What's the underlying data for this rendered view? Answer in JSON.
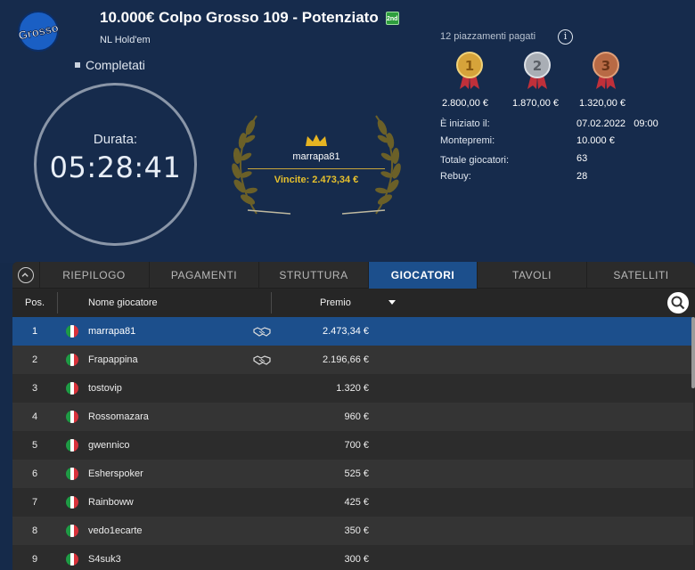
{
  "tournament": {
    "title": "10.000€ Colpo Grosso 109 - Potenziato",
    "badge": "2nd",
    "game_type": "NL Hold'em",
    "status": "Completati",
    "logo_text": "Grosso"
  },
  "clock": {
    "label": "Durata:",
    "time": "05:28:41"
  },
  "winner": {
    "name": "marrapa81",
    "prize": "Vincite: 2.473,34 €"
  },
  "payouts": {
    "places_text": "12 piazzamenti pagati",
    "medals": [
      {
        "rank": "1",
        "amount": "2.800,00 €",
        "color": "#d6a33a"
      },
      {
        "rank": "2",
        "amount": "1.870,00 €",
        "color": "#a9aeb5"
      },
      {
        "rank": "3",
        "amount": "1.320,00 €",
        "color": "#b86a45"
      }
    ]
  },
  "stats": [
    {
      "label": "È iniziato il:",
      "value": "07.02.2022   09:00"
    },
    {
      "label": "Montepremi:",
      "value": "10.000 €"
    },
    {
      "label": "Totale giocatori:",
      "value": "63"
    },
    {
      "label": "Rebuy:",
      "value": "28"
    }
  ],
  "tabs": [
    "RIEPILOGO",
    "PAGAMENTI",
    "STRUTTURA",
    "GIOCATORI",
    "TAVOLI",
    "SATELLITI"
  ],
  "active_tab": "GIOCATORI",
  "columns": {
    "pos": "Pos.",
    "name": "Nome giocatore",
    "prize": "Premio"
  },
  "players": [
    {
      "pos": "1",
      "name": "marrapa81",
      "deal": true,
      "prize": "2.473,34 €"
    },
    {
      "pos": "2",
      "name": "Frapappina",
      "deal": true,
      "prize": "2.196,66 €"
    },
    {
      "pos": "3",
      "name": "tostovip",
      "deal": false,
      "prize": "1.320 €"
    },
    {
      "pos": "4",
      "name": "Rossomazara",
      "deal": false,
      "prize": "960 €"
    },
    {
      "pos": "5",
      "name": "gwennico",
      "deal": false,
      "prize": "700 €"
    },
    {
      "pos": "6",
      "name": "Esherspoker",
      "deal": false,
      "prize": "525 €"
    },
    {
      "pos": "7",
      "name": "Rainboww",
      "deal": false,
      "prize": "425 €"
    },
    {
      "pos": "8",
      "name": "vedo1ecarte",
      "deal": false,
      "prize": "350 €"
    },
    {
      "pos": "9",
      "name": "S4suk3",
      "deal": false,
      "prize": "300 €"
    }
  ],
  "colors": {
    "accent": "#1c4f8c",
    "gold": "#e6c02d",
    "header_bg": "#162b4c"
  }
}
